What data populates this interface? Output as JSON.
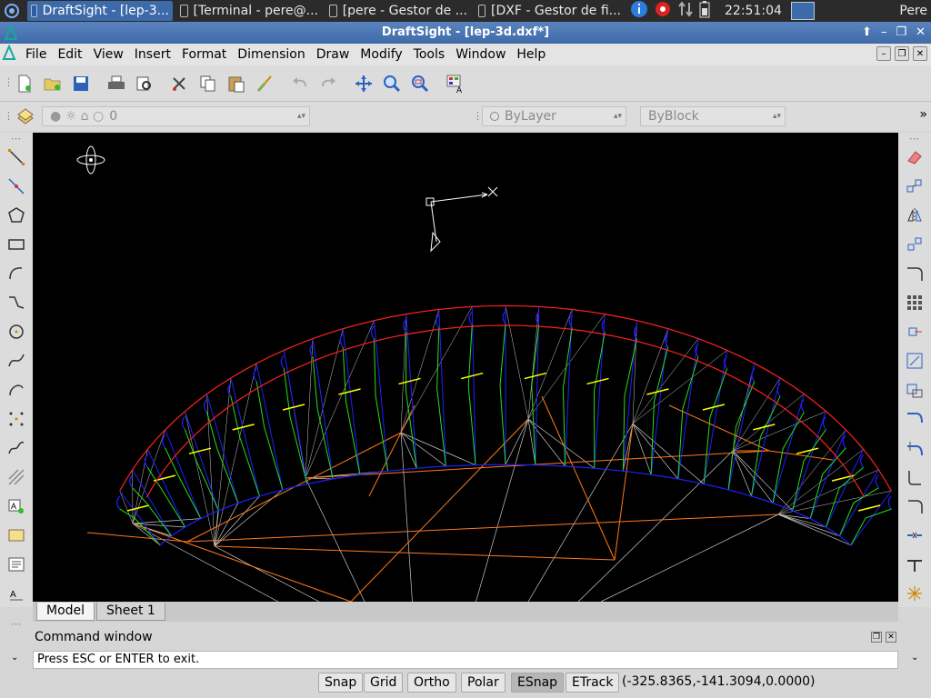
{
  "taskbar": {
    "tasks": [
      {
        "label": "DraftSight - [lep-3...",
        "active": true
      },
      {
        "label": "[Terminal - pere@...",
        "active": false
      },
      {
        "label": "[pere - Gestor de ...",
        "active": false
      },
      {
        "label": "[DXF - Gestor de fi...",
        "active": false
      }
    ],
    "clock": "22:51:04",
    "user": "Pere"
  },
  "window": {
    "title": "DraftSight - [lep-3d.dxf*]"
  },
  "menu": {
    "items": [
      "File",
      "Edit",
      "View",
      "Insert",
      "Format",
      "Dimension",
      "Draw",
      "Modify",
      "Tools",
      "Window",
      "Help"
    ]
  },
  "layers": {
    "current_layer": "0",
    "color": "ByLayer",
    "linetype": "ByBlock"
  },
  "tabs": [
    "Model",
    "Sheet 1"
  ],
  "command": {
    "title": "Command window",
    "prompt": "Press ESC or ENTER to exit."
  },
  "status": {
    "toggles": [
      {
        "label": "Snap",
        "on": false
      },
      {
        "label": "Grid",
        "on": false
      },
      {
        "label": "Ortho",
        "on": false
      },
      {
        "label": "Polar",
        "on": false
      },
      {
        "label": "ESnap",
        "on": true
      },
      {
        "label": "ETrack",
        "on": false
      }
    ],
    "coords": "(-325.8365,-141.3094,0.0000)"
  },
  "drawing_colors": {
    "canopy_outline": "#ff2020",
    "leading_edge": "#2020ff",
    "ribs": "#20e020",
    "diagonals": "#ffff00",
    "lines_upper": "#c8c8c8",
    "lines_lower": "#ff7a1a"
  }
}
